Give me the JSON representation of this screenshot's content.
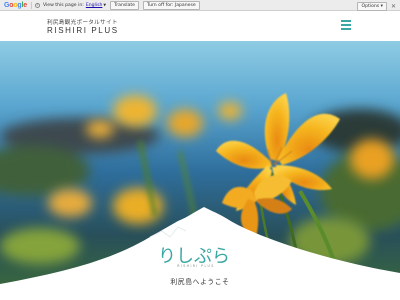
{
  "translate_bar": {
    "view_text": "View this page in:",
    "language": "English",
    "translate_label": "Translate",
    "turn_off_label": "Turn off for: Japanese",
    "options_label": "Options ▾",
    "close_symbol": "✕"
  },
  "header": {
    "tagline": "利尻島観光ポータルサイト",
    "brand": "RISHIRI PLUS"
  },
  "hero": {
    "logo_text": "りしぷら",
    "logo_subtext": "RISHIRI PLUS",
    "welcome": "利尻島へようこそ"
  },
  "colors": {
    "accent": "#3aa7a4",
    "flower": "#f5b41e",
    "sea": "#2e6f9c"
  }
}
